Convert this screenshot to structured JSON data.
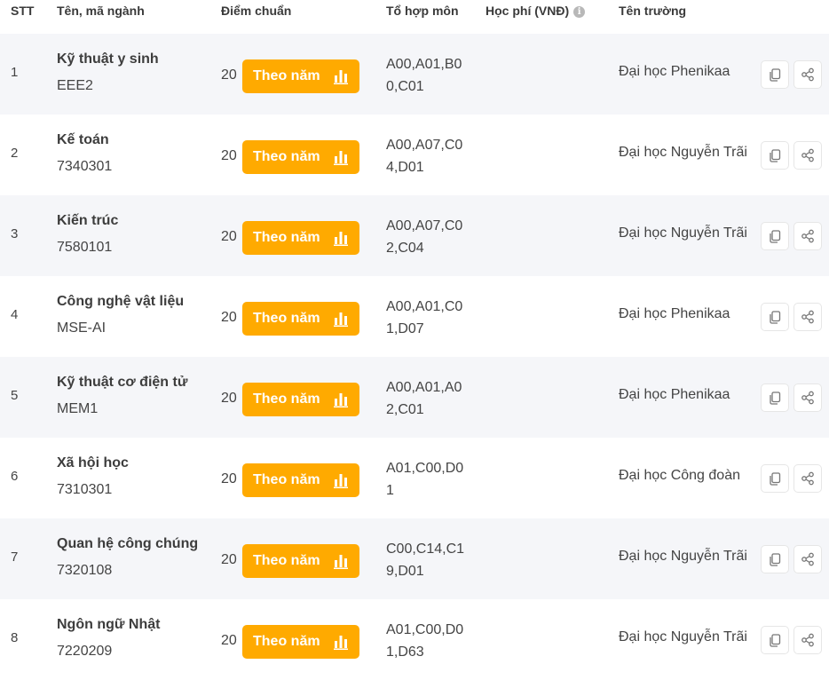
{
  "header": {
    "stt": "STT",
    "name_code": "Tên, mã ngành",
    "score": "Điểm chuẩn",
    "combo": "Tổ hợp môn",
    "fee": "Học phí (VNĐ)",
    "fee_info_icon": "i",
    "school": "Tên trường"
  },
  "colors": {
    "accent": "#ffaa00",
    "row_alt": "#f5f6f9"
  },
  "rows": [
    {
      "stt": "1",
      "name": "Kỹ thuật y sinh",
      "code": "EEE2",
      "score": "20",
      "button": "Theo năm",
      "combo": "A00,A01,B00,C01",
      "fee": "",
      "school": "Đại học Phenikaa"
    },
    {
      "stt": "2",
      "name": "Kế toán",
      "code": "7340301",
      "score": "20",
      "button": "Theo năm",
      "combo": "A00,A07,C04,D01",
      "fee": "",
      "school": "Đại học Nguyễn Trãi"
    },
    {
      "stt": "3",
      "name": "Kiến trúc",
      "code": "7580101",
      "score": "20",
      "button": "Theo năm",
      "combo": "A00,A07,C02,C04",
      "fee": "",
      "school": "Đại học Nguyễn Trãi"
    },
    {
      "stt": "4",
      "name": "Công nghệ vật liệu",
      "code": "MSE-AI",
      "score": "20",
      "button": "Theo năm",
      "combo": "A00,A01,C01,D07",
      "fee": "",
      "school": "Đại học Phenikaa"
    },
    {
      "stt": "5",
      "name": "Kỹ thuật cơ điện tử",
      "code": "MEM1",
      "score": "20",
      "button": "Theo năm",
      "combo": "A00,A01,A02,C01",
      "fee": "",
      "school": "Đại học Phenikaa"
    },
    {
      "stt": "6",
      "name": "Xã hội học",
      "code": "7310301",
      "score": "20",
      "button": "Theo năm",
      "combo": "A01,C00,D01",
      "fee": "",
      "school": "Đại học Công đoàn"
    },
    {
      "stt": "7",
      "name": "Quan hệ công chúng",
      "code": "7320108",
      "score": "20",
      "button": "Theo năm",
      "combo": "C00,C14,C19,D01",
      "fee": "",
      "school": "Đại học Nguyễn Trãi"
    },
    {
      "stt": "8",
      "name": "Ngôn ngữ Nhật",
      "code": "7220209",
      "score": "20",
      "button": "Theo năm",
      "combo": "A01,C00,D01,D63",
      "fee": "",
      "school": "Đại học Nguyễn Trãi"
    }
  ]
}
